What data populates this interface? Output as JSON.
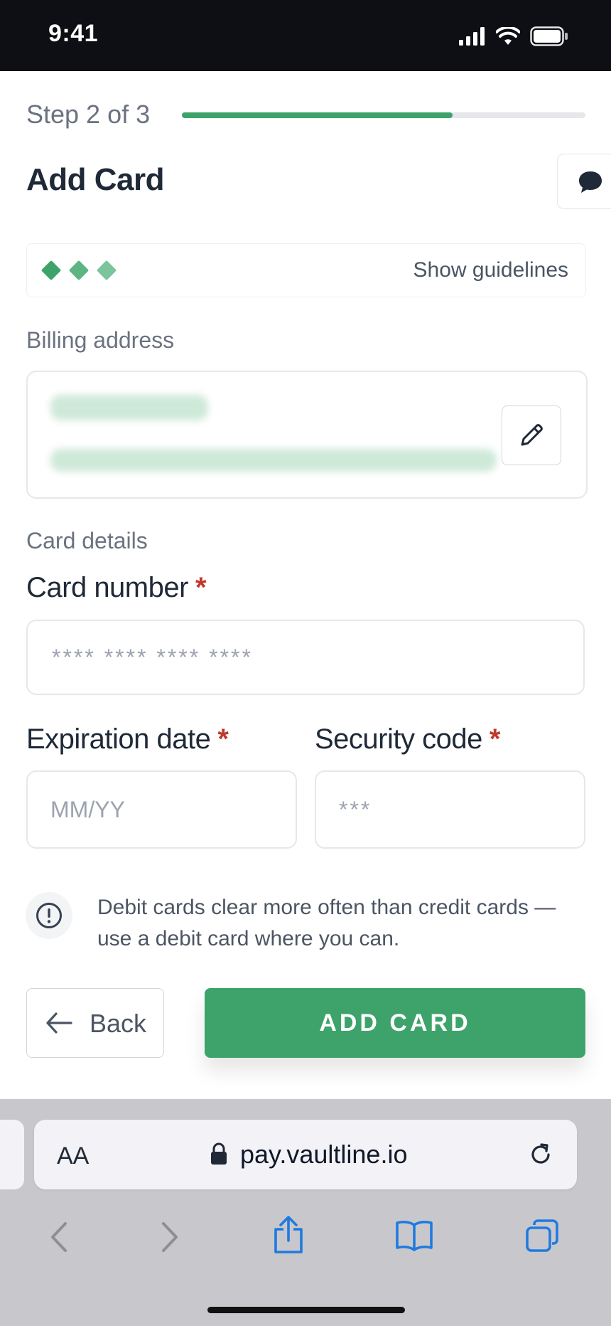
{
  "status_bar": {
    "time": "9:41",
    "icons": [
      "signal-icon",
      "wifi-icon",
      "battery-icon"
    ]
  },
  "progress": {
    "step_label": "Step 2 of 3",
    "fraction": 0.67
  },
  "page": {
    "title": "Add Card",
    "chat_icon": "chat-bubble-icon"
  },
  "guidelines": {
    "link_label": "Show guidelines",
    "diamond_colors": [
      "#3da36a",
      "#5cb583",
      "#7cc49c"
    ]
  },
  "billing": {
    "section_label": "Billing address",
    "edit_icon": "pencil-icon"
  },
  "card_details": {
    "section_label": "Card details",
    "card_number": {
      "label": "Card number",
      "required_mark": "*",
      "placeholder": "**** **** **** ****"
    },
    "expiration": {
      "label": "Expiration date",
      "required_mark": "*",
      "placeholder": "MM/YY"
    },
    "security": {
      "label": "Security code",
      "required_mark": "*",
      "placeholder": "***"
    }
  },
  "notice": {
    "icon": "info-icon",
    "text": "Debit cards clear more often than credit cards — use a debit card where you can."
  },
  "actions": {
    "back_label": "Back",
    "back_icon": "arrow-left-icon",
    "add_label": "ADD CARD"
  },
  "browser": {
    "text_size_label": "AA",
    "url": "pay.vaultline.io",
    "toolbar_icons": [
      "back-chevron-icon",
      "forward-chevron-icon",
      "share-icon",
      "bookmarks-icon",
      "tabs-icon"
    ]
  },
  "colors": {
    "accent": "#3da36a",
    "required": "#c0392b",
    "status_bar_bg": "#0d0f14"
  }
}
